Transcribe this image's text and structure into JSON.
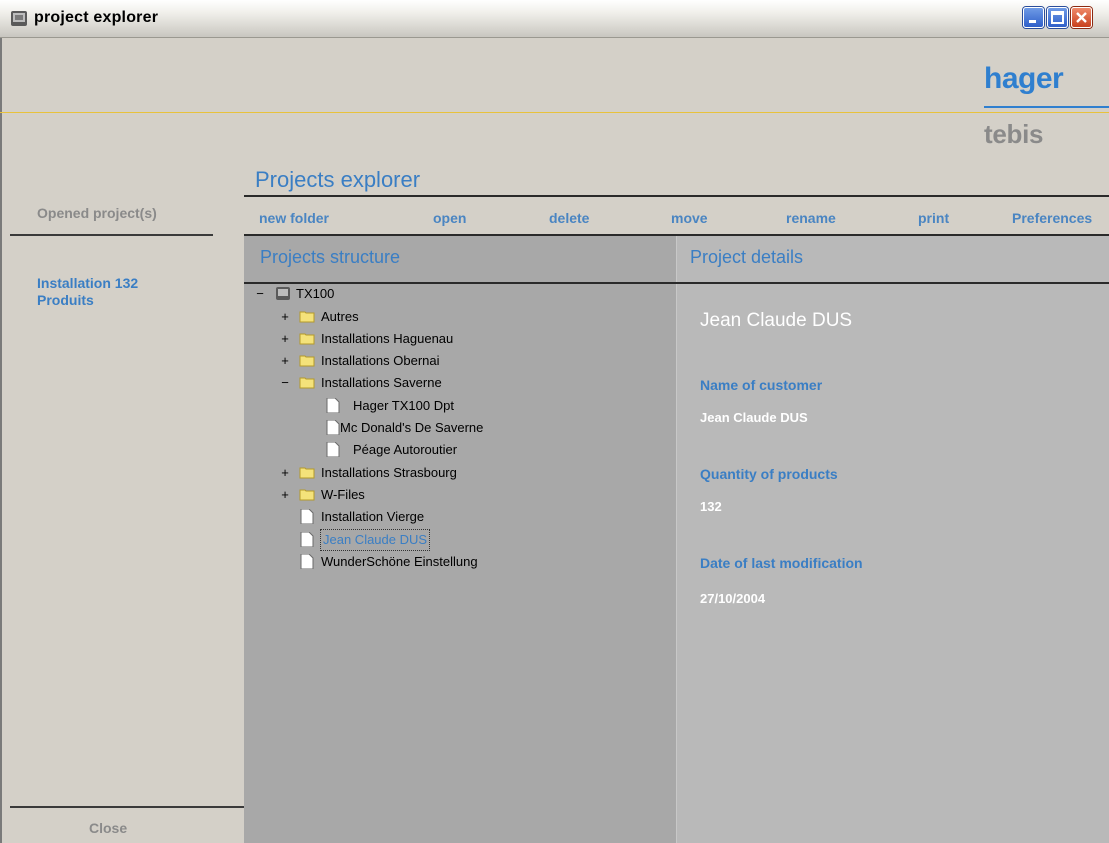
{
  "window": {
    "title": "project explorer"
  },
  "brand": {
    "primary": "hager",
    "secondary": "tebis"
  },
  "sidebar": {
    "opened_label": "Opened project(s)",
    "projects": [
      {
        "label": "Installation 132\nProduits"
      }
    ],
    "close_label": "Close"
  },
  "main": {
    "title": "Projects explorer",
    "toolbar": [
      "new folder",
      "open",
      "delete",
      "move",
      "rename",
      "print",
      "Preferences"
    ]
  },
  "structure": {
    "title": "Projects structure",
    "tree": [
      {
        "label": "TX100",
        "toggle": "−",
        "icon": "device-icon"
      },
      {
        "label": "Autres",
        "toggle": "+",
        "icon": "folder-icon"
      },
      {
        "label": "Installations Haguenau",
        "toggle": "+",
        "icon": "folder-icon"
      },
      {
        "label": "Installations Obernai",
        "toggle": "+",
        "icon": "folder-icon"
      },
      {
        "label": "Installations Saverne",
        "toggle": "−",
        "icon": "folder-icon"
      },
      {
        "label": "Hager TX100 Dpt",
        "toggle": "",
        "icon": "document-icon"
      },
      {
        "label": "Mc Donald's De Saverne",
        "toggle": "",
        "icon": "document-icon"
      },
      {
        "label": "Péage Autoroutier",
        "toggle": "",
        "icon": "document-icon"
      },
      {
        "label": "Installations Strasbourg",
        "toggle": "+",
        "icon": "folder-icon"
      },
      {
        "label": "W-Files",
        "toggle": "+",
        "icon": "folder-icon"
      },
      {
        "label": "Installation Vierge",
        "toggle": "",
        "icon": "document-icon"
      },
      {
        "label": "Jean Claude DUS",
        "toggle": "",
        "icon": "document-icon",
        "selected": true
      },
      {
        "label": "WunderSchöne Einstellung",
        "toggle": "",
        "icon": "document-icon"
      }
    ]
  },
  "details": {
    "title": "Project details",
    "name": "Jean Claude DUS",
    "customer_label": "Name of customer",
    "customer_value": "Jean Claude DUS",
    "quantity_label": "Quantity of products",
    "quantity_value": "132",
    "date_label": "Date of last modification",
    "date_value": "27/10/2004"
  },
  "colors": {
    "accent": "#3a7ec4",
    "brand_line": "#e8c23c",
    "panel_left": "#a8a8a8",
    "panel_right": "#b9b9b9"
  }
}
